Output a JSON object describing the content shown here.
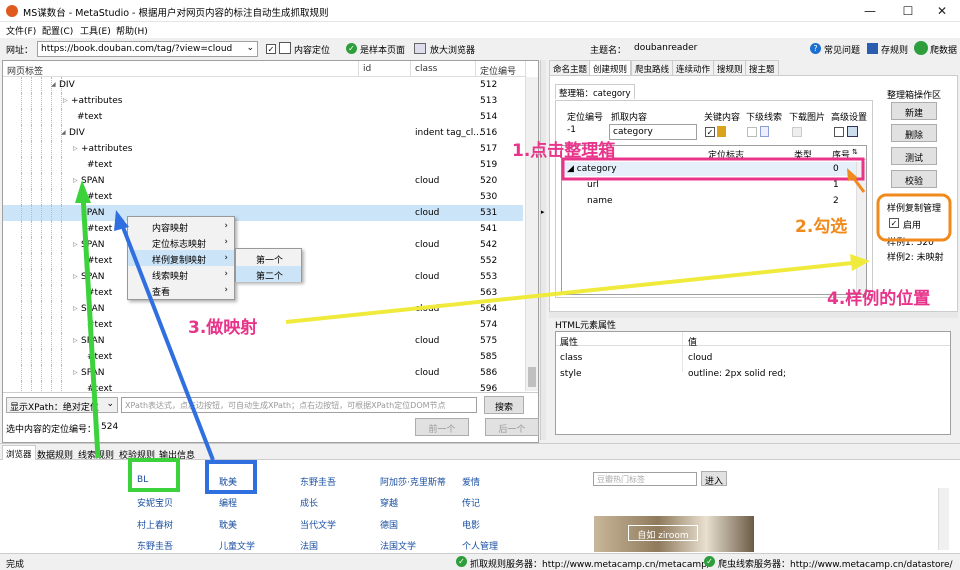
{
  "window": {
    "title": "MS谋数台 - MetaStudio - 根据用户对网页内容的标注自动生成抓取规则",
    "min": "—",
    "max": "☐",
    "close": "✕"
  },
  "menu": [
    "文件(F)",
    "配置(C)",
    "工具(E)",
    "帮助(H)"
  ],
  "urlbar": {
    "label": "网址：",
    "url": "https://book.douban.com/tag/?view=cloud",
    "content_locate": "内容定位",
    "sample_page": "是样本页面",
    "zoom_browser": "放大浏览器",
    "topic_label": "主题名：",
    "topic_value": "doubanreader",
    "faq": "常见问题",
    "save_rule": "存规则",
    "crawl": "爬数据"
  },
  "tree": {
    "headers": [
      "网页标签",
      "id",
      "class",
      "定位编号"
    ],
    "rows": [
      {
        "tag": "DIV",
        "cls": "",
        "pos": "512"
      },
      {
        "tag": "+attributes",
        "cls": "",
        "pos": "513"
      },
      {
        "tag": "#text",
        "cls": "",
        "pos": "514"
      },
      {
        "tag": "DIV",
        "cls": "indent tag_cl...",
        "pos": "516"
      },
      {
        "tag": "+attributes",
        "cls": "",
        "pos": "517"
      },
      {
        "tag": "#text",
        "cls": "",
        "pos": "519"
      },
      {
        "tag": "SPAN",
        "cls": "cloud",
        "pos": "520"
      },
      {
        "tag": "#text",
        "cls": "",
        "pos": "530"
      },
      {
        "tag": "SPAN",
        "cls": "cloud",
        "pos": "531"
      },
      {
        "tag": "#text",
        "cls": "",
        "pos": "541"
      },
      {
        "tag": "SPAN",
        "cls": "cloud",
        "pos": "542"
      },
      {
        "tag": "#text",
        "cls": "",
        "pos": "552"
      },
      {
        "tag": "SPAN",
        "cls": "cloud",
        "pos": "553"
      },
      {
        "tag": "#text",
        "cls": "",
        "pos": "563"
      },
      {
        "tag": "SPAN",
        "cls": "cloud",
        "pos": "564"
      },
      {
        "tag": "#text",
        "cls": "",
        "pos": "574"
      },
      {
        "tag": "SPAN",
        "cls": "cloud",
        "pos": "575"
      },
      {
        "tag": "#text",
        "cls": "",
        "pos": "585"
      },
      {
        "tag": "SPAN",
        "cls": "cloud",
        "pos": "586"
      },
      {
        "tag": "#text",
        "cls": "",
        "pos": "596"
      }
    ]
  },
  "context_menu": [
    "内容映射",
    "定位标志映射",
    "样例复制映射",
    "线索映射",
    "查看"
  ],
  "sub_menu": [
    "第一个",
    "第二个"
  ],
  "xpath": {
    "mode": "显示XPath：绝对定位",
    "placeholder": "XPath表达式，点左边按钮，可自动生成XPath；点右边按钮，可根据XPath定位DOM节点",
    "search": "搜索",
    "selected": "选中内容的定位编号：",
    "selected_value": "524",
    "prev": "前一个",
    "next": "后一个"
  },
  "right_tabs": [
    "命名主题",
    "创建规则",
    "爬虫路线",
    "连续动作",
    "搜规则",
    "搜主题"
  ],
  "organize": {
    "box_title": "整理箱：category",
    "headers": [
      "定位编号",
      "抓取内容",
      "关键内容",
      "下级线索",
      "下载图片",
      "高级设置"
    ],
    "row_pos": "-1",
    "row_name": "category",
    "col_loc": "定位标志",
    "col_type": "类型",
    "col_seq": "序号",
    "items": [
      {
        "name": "category",
        "seq": "0"
      },
      {
        "name": "url",
        "seq": "1"
      },
      {
        "name": "name",
        "seq": "2"
      }
    ]
  },
  "ops": {
    "title": "整理箱操作区",
    "new": "新建",
    "delete": "删除",
    "test": "测试",
    "verify": "校验"
  },
  "sample": {
    "title": "样例复制管理",
    "enable": "启用",
    "s1": "样例1: 520",
    "s2": "样例2: 未映射"
  },
  "html_attr": {
    "title": "HTML元素属性",
    "headers": [
      "属性",
      "值"
    ],
    "rows": [
      {
        "k": "class",
        "v": "cloud"
      },
      {
        "k": "style",
        "v": "outline: 2px solid red;"
      }
    ]
  },
  "bottom_tabs": [
    "浏览器",
    "数据规则",
    "线索规则",
    "校验规则",
    "输出信息"
  ],
  "tags": [
    [
      "BL",
      "安妮宝贝",
      "村上春树",
      "东野圭吾"
    ],
    [
      "耽美",
      "编程",
      "耽美",
      "儿童文学"
    ],
    [
      "东野圭吾",
      "成长",
      "当代文学",
      "法国"
    ],
    [
      "阿加莎·克里斯蒂",
      "穿越",
      "德国",
      "法国文学"
    ],
    [
      "爱情",
      "传记",
      "电影",
      "个人管理"
    ]
  ],
  "search_input": {
    "placeholder": "豆瓣热门标签",
    "button": "进入"
  },
  "banner": "自如 ziroom",
  "annotations": {
    "a1": "1.点击整理箱",
    "a2": "2.勾选",
    "a3": "3.做映射",
    "a4": "4.样例的位置"
  },
  "status": {
    "done": "完成",
    "s1": "抓取规则服务器：http://www.metacamp.cn/metacamp/",
    "s2": "爬虫线索服务器：http://www.metacamp.cn/datastore/"
  },
  "colors": {
    "pink": "#e8348a",
    "green": "#3cd23c",
    "blue": "#2f6fe0",
    "orange": "#f08a1c",
    "yellow": "#f0ea3c"
  }
}
